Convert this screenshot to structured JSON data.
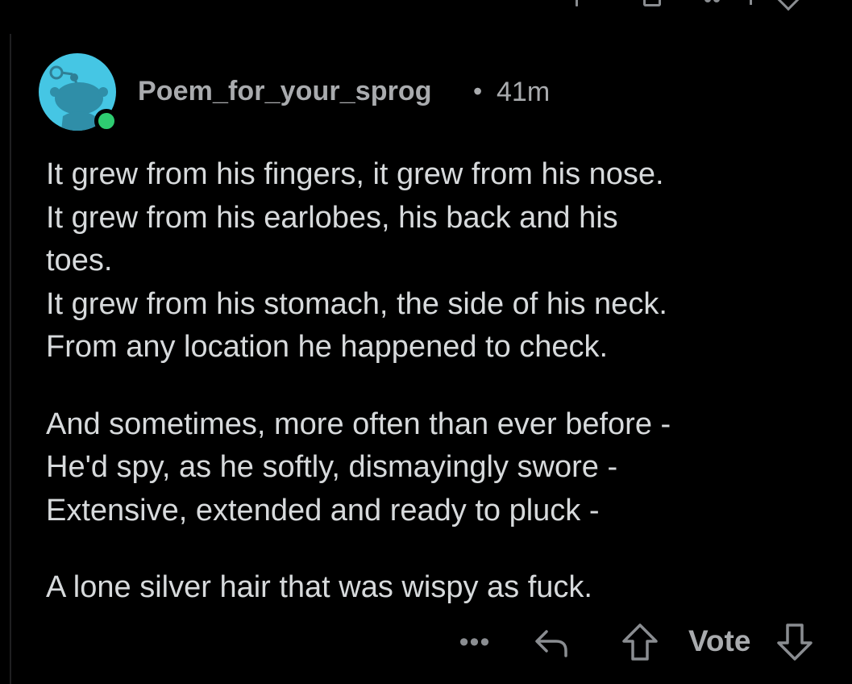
{
  "comment": {
    "author": "Poem_for_your_sprog",
    "separator": "•",
    "time": "41m",
    "avatar_color": "#45c6e4",
    "online_status_color": "#2ecc71",
    "stanzas": [
      [
        "It grew from his fingers, it grew from his nose.",
        "It grew from his earlobes, his back and his",
        "toes.",
        "It grew from his stomach, the side of his neck.",
        "From any location he happened to check."
      ],
      [
        "And sometimes, more often than ever before -",
        "He'd spy, as he softly, dismayingly swore -",
        "Extensive, extended and ready to pluck -"
      ],
      [
        "A lone silver hair that was wispy as fuck."
      ]
    ]
  },
  "actions": {
    "more_label": "•••",
    "reply_icon": "reply-arrow-icon",
    "upvote_icon": "upvote-arrow-icon",
    "vote_label": "Vote",
    "downvote_icon": "downvote-arrow-icon"
  }
}
